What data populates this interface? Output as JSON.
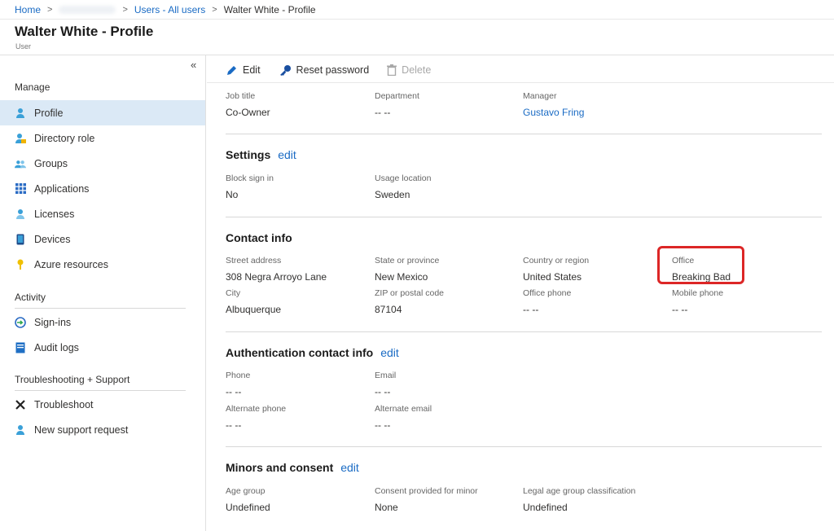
{
  "breadcrumb": {
    "home": "Home",
    "users": "Users - All users",
    "current": "Walter White - Profile"
  },
  "header": {
    "title": "Walter White - Profile",
    "subtitle": "User"
  },
  "sidebar": {
    "collapse_glyph": "«",
    "manage_heading": "Manage",
    "manage_items": [
      {
        "label": "Profile",
        "icon": "user-icon",
        "active": true
      },
      {
        "label": "Directory role",
        "icon": "directory-role-icon"
      },
      {
        "label": "Groups",
        "icon": "groups-icon"
      },
      {
        "label": "Applications",
        "icon": "apps-grid-icon"
      },
      {
        "label": "Licenses",
        "icon": "licenses-icon"
      },
      {
        "label": "Devices",
        "icon": "device-icon"
      },
      {
        "label": "Azure resources",
        "icon": "key-icon"
      }
    ],
    "activity_heading": "Activity",
    "activity_items": [
      {
        "label": "Sign-ins",
        "icon": "sign-ins-icon"
      },
      {
        "label": "Audit logs",
        "icon": "audit-log-icon"
      }
    ],
    "support_heading": "Troubleshooting + Support",
    "support_items": [
      {
        "label": "Troubleshoot",
        "icon": "tools-icon"
      },
      {
        "label": "New support request",
        "icon": "support-icon"
      }
    ]
  },
  "toolbar": {
    "edit": "Edit",
    "reset_password": "Reset password",
    "delete": "Delete"
  },
  "job": {
    "job_title_label": "Job title",
    "job_title": "Co-Owner",
    "department_label": "Department",
    "department": "-- --",
    "manager_label": "Manager",
    "manager": "Gustavo Fring"
  },
  "settings": {
    "title": "Settings",
    "edit": "edit",
    "block_label": "Block sign in",
    "block": "No",
    "usage_label": "Usage location",
    "usage": "Sweden"
  },
  "contact": {
    "title": "Contact info",
    "street_label": "Street address",
    "street": "308 Negra Arroyo Lane",
    "state_label": "State or province",
    "state": "New Mexico",
    "country_label": "Country or region",
    "country": "United States",
    "office_label": "Office",
    "office": "Breaking Bad",
    "city_label": "City",
    "city": "Albuquerque",
    "zip_label": "ZIP or postal code",
    "zip": "87104",
    "office_phone_label": "Office phone",
    "office_phone": "-- --",
    "mobile_label": "Mobile phone",
    "mobile": "-- --"
  },
  "auth": {
    "title": "Authentication contact info",
    "edit": "edit",
    "phone_label": "Phone",
    "phone": "-- --",
    "email_label": "Email",
    "email": "-- --",
    "alt_phone_label": "Alternate phone",
    "alt_phone": "-- --",
    "alt_email_label": "Alternate email",
    "alt_email": "-- --"
  },
  "minors": {
    "title": "Minors and consent",
    "edit": "edit",
    "age_label": "Age group",
    "age": "Undefined",
    "consent_label": "Consent provided for minor",
    "consent": "None",
    "legal_label": "Legal age group classification",
    "legal": "Undefined"
  },
  "colors": {
    "link": "#1a6bc4",
    "active_nav": "#dbe9f6",
    "annotation": "#dc2626"
  }
}
